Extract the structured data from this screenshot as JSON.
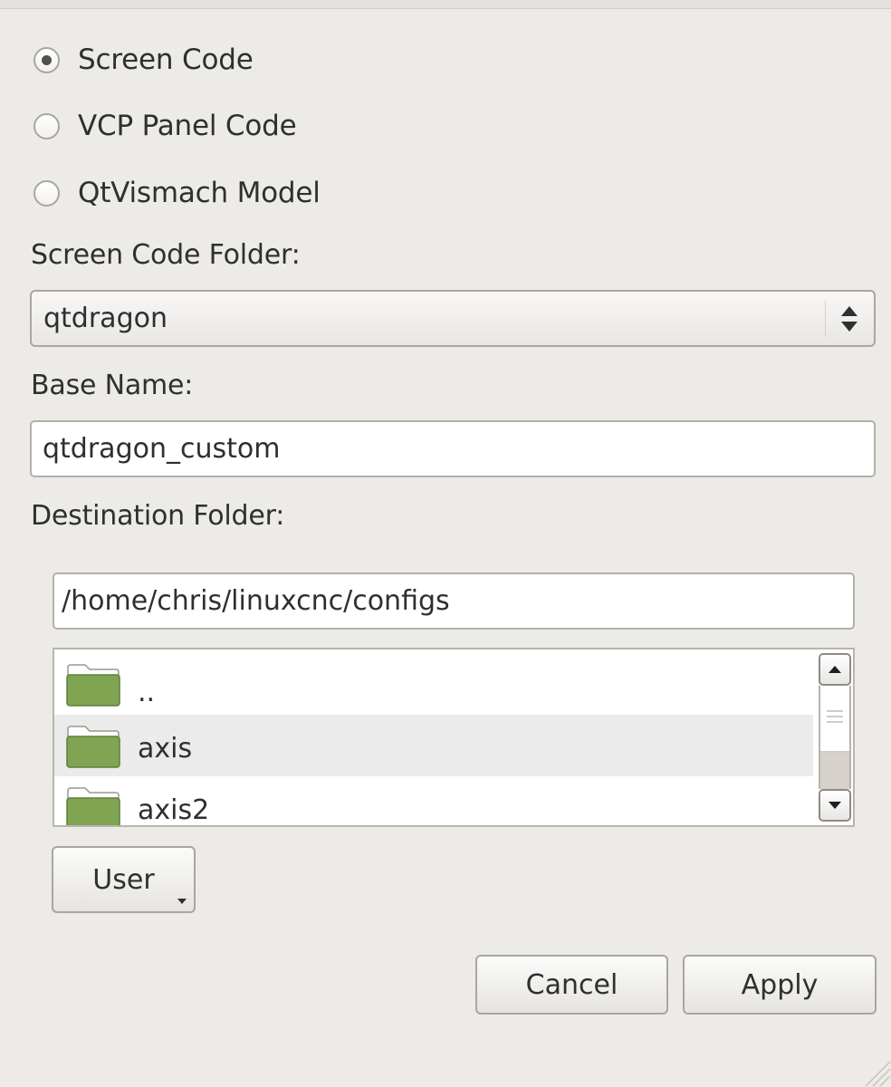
{
  "mode_options": [
    {
      "label": "Screen Code",
      "selected": true
    },
    {
      "label": "VCP Panel Code",
      "selected": false
    },
    {
      "label": "QtVismach Model",
      "selected": false
    }
  ],
  "screen_code_folder": {
    "label": "Screen Code Folder:",
    "value": "qtdragon"
  },
  "base_name": {
    "label": "Base Name:",
    "value": "qtdragon_custom"
  },
  "destination": {
    "label": "Destination Folder:",
    "path": "/home/chris/linuxcnc/configs",
    "entries": [
      {
        "name": ".."
      },
      {
        "name": "axis"
      },
      {
        "name": "axis2"
      }
    ],
    "user_button": "User"
  },
  "buttons": {
    "cancel": "Cancel",
    "apply": "Apply"
  },
  "colors": {
    "background": "#edebe8",
    "folder": "#7fa552",
    "selected_radio_dot": "#505050"
  }
}
